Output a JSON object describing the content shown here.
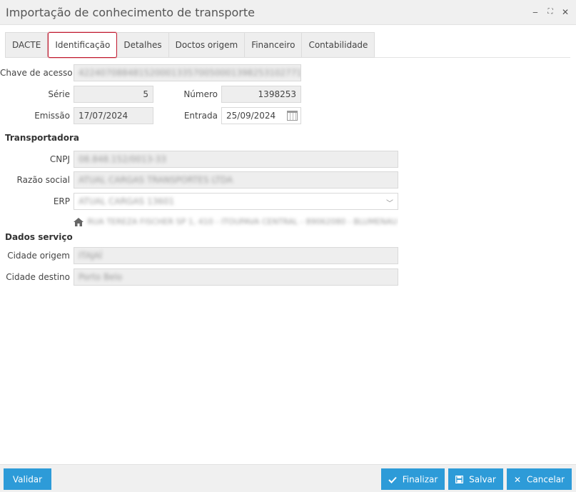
{
  "window": {
    "title": "Importação de conhecimento de transporte",
    "minimize": "‒",
    "maximize": "⛶",
    "close": "✕"
  },
  "tabs": [
    {
      "label": "DACTE"
    },
    {
      "label": "Identificação"
    },
    {
      "label": "Detalhes"
    },
    {
      "label": "Doctos origem"
    },
    {
      "label": "Financeiro"
    },
    {
      "label": "Contabilidade"
    }
  ],
  "active_tab": "Identificação",
  "form": {
    "chave_label": "Chave de acesso",
    "chave_value": "42240708848152000133570050001398253102771210",
    "serie_label": "Série",
    "serie_value": "5",
    "numero_label": "Número",
    "numero_value": "1398253",
    "emissao_label": "Emissão",
    "emissao_value": "17/07/2024",
    "entrada_label": "Entrada",
    "entrada_value": "25/09/2024"
  },
  "transportadora": {
    "section_title": "Transportadora",
    "cnpj_label": "CNPJ",
    "cnpj_value": "08.848.152/0013-33",
    "razao_label": "Razão social",
    "razao_value": "ATUAL CARGAS TRANSPORTES LTDA",
    "erp_label": "ERP",
    "erp_value": "ATUAL CARGAS 13601",
    "address": "RUA TEREZA FISCHER SP 1, 410 - ITOUPAVA CENTRAL - 89062080 - BLUMENAU - SC"
  },
  "servico": {
    "section_title": "Dados serviço",
    "origem_label": "Cidade origem",
    "origem_value": "ITAJAÍ",
    "destino_label": "Cidade destino",
    "destino_value": "Porto Belo"
  },
  "footer": {
    "validar": "Validar",
    "finalizar": "Finalizar",
    "salvar": "Salvar",
    "cancelar": "Cancelar"
  },
  "colors": {
    "primary_button": "#2d9bd8",
    "active_tab_border": "#c0172d"
  },
  "icons": {
    "calendar": "calendar-icon",
    "home": "home-icon",
    "check": "check-icon",
    "save": "floppy-icon",
    "cancel": "close-icon"
  }
}
